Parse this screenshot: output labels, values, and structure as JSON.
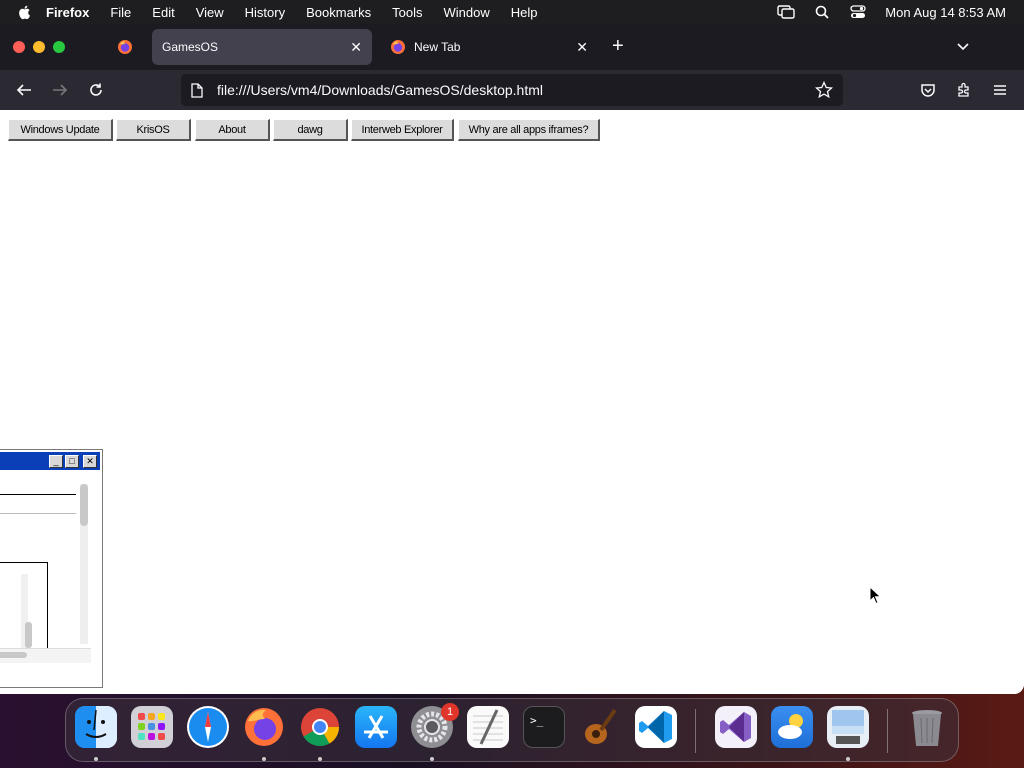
{
  "menubar": {
    "app_name": "Firefox",
    "items": [
      "File",
      "Edit",
      "View",
      "History",
      "Bookmarks",
      "Tools",
      "Window",
      "Help"
    ],
    "clock": "Mon Aug 14  8:53 AM"
  },
  "browser": {
    "tabs": [
      {
        "title": "GamesOS",
        "active": true
      },
      {
        "title": "New Tab",
        "active": false
      }
    ],
    "url": "file:///Users/vm4/Downloads/GamesOS/desktop.html"
  },
  "page": {
    "buttons": [
      "Windows Update",
      "KrisOS",
      "About",
      "dawg",
      "Interweb Explorer",
      "Why are all apps iframes?"
    ]
  },
  "dock": {
    "apps": [
      "Finder",
      "Launchpad",
      "Safari",
      "Firefox",
      "Chrome",
      "App Store",
      "System Settings",
      "TextEdit",
      "Terminal",
      "GarageBand",
      "Visual Studio Code",
      "Visual Studio",
      "Weather",
      "Preview",
      "Trash"
    ],
    "settings_badge": "1"
  },
  "colors": {
    "tabbar": "#1c1b22",
    "navbar": "#2b2a33",
    "active_tab": "#42414d",
    "retro_titlebar": "#0a3fb8"
  }
}
